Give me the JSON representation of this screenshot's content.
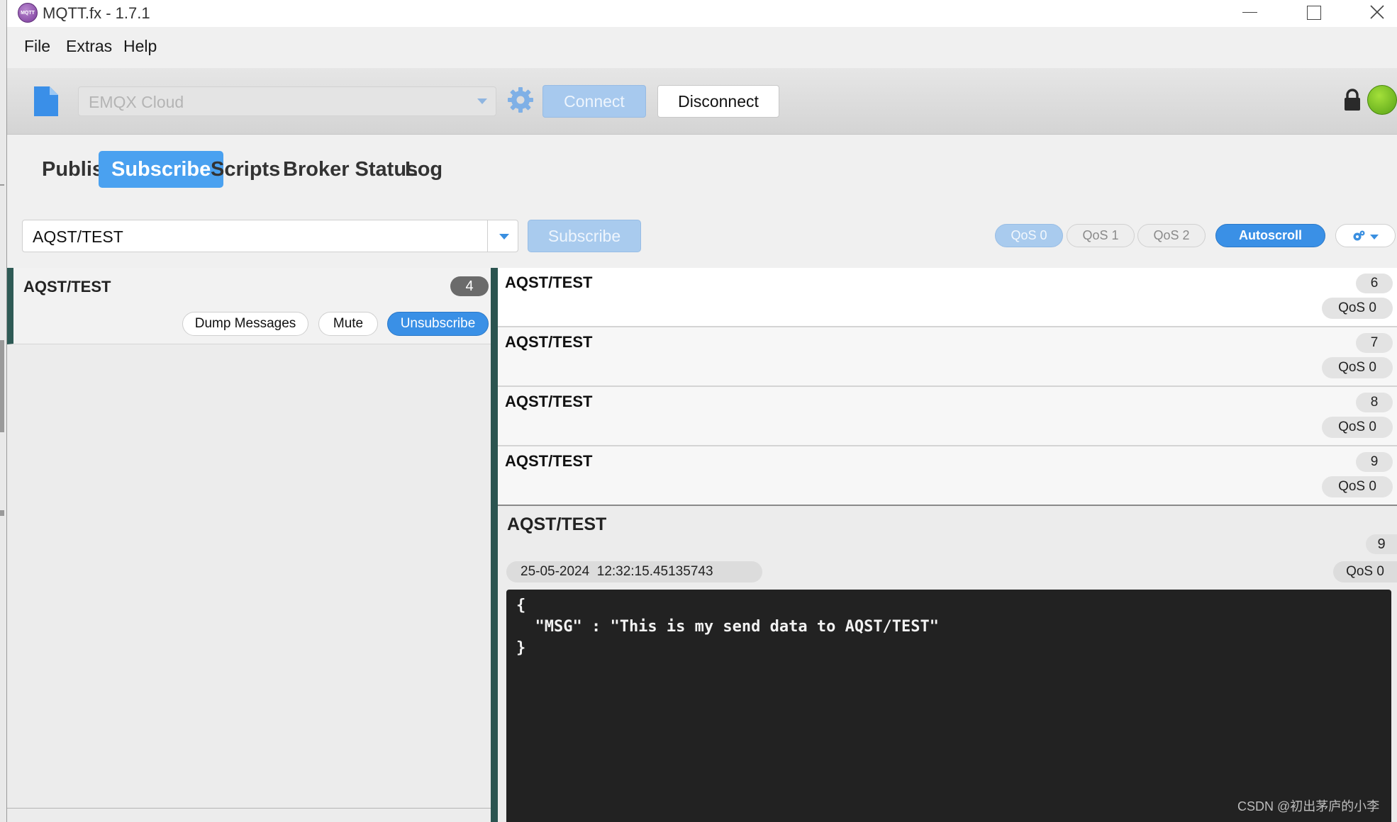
{
  "window": {
    "title": "MQTT.fx - 1.7.1",
    "logo_text": "MQTT fx"
  },
  "menu": [
    "File",
    "Extras",
    "Help"
  ],
  "toolbar": {
    "profile": "EMQX Cloud",
    "connect_label": "Connect",
    "disconnect_label": "Disconnect",
    "connection_status_color": "#6ebf22"
  },
  "tabs": [
    "Publish",
    "Subscribe",
    "Scripts",
    "Broker Status",
    "Log"
  ],
  "active_tab": "Subscribe",
  "subscribe_bar": {
    "topic": "AQST/TEST",
    "subscribe_label": "Subscribe",
    "qos_options": [
      "QoS 0",
      "QoS 1",
      "QoS 2"
    ],
    "selected_qos": "QoS 0",
    "autoscroll_label": "Autoscroll"
  },
  "subscriptions": [
    {
      "topic": "AQST/TEST",
      "count": "4",
      "dump_label": "Dump Messages",
      "mute_label": "Mute",
      "unsubscribe_label": "Unsubscribe"
    }
  ],
  "messages": [
    {
      "topic": "AQST/TEST",
      "num": "6",
      "qos": "QoS 0"
    },
    {
      "topic": "AQST/TEST",
      "num": "7",
      "qos": "QoS 0"
    },
    {
      "topic": "AQST/TEST",
      "num": "8",
      "qos": "QoS 0"
    },
    {
      "topic": "AQST/TEST",
      "num": "9",
      "qos": "QoS 0"
    }
  ],
  "detail": {
    "topic": "AQST/TEST",
    "num": "9",
    "timestamp": "25-05-2024  12:32:15.45135743",
    "qos": "QoS 0",
    "payload": "{\n  \"MSG\" : \"This is my send data to AQST/TEST\"\n}"
  },
  "watermark": "CSDN @初出茅庐的小李",
  "colors": {
    "accent": "#3a90e6",
    "splitter": "#2b5450",
    "payload_bg": "#222222"
  }
}
